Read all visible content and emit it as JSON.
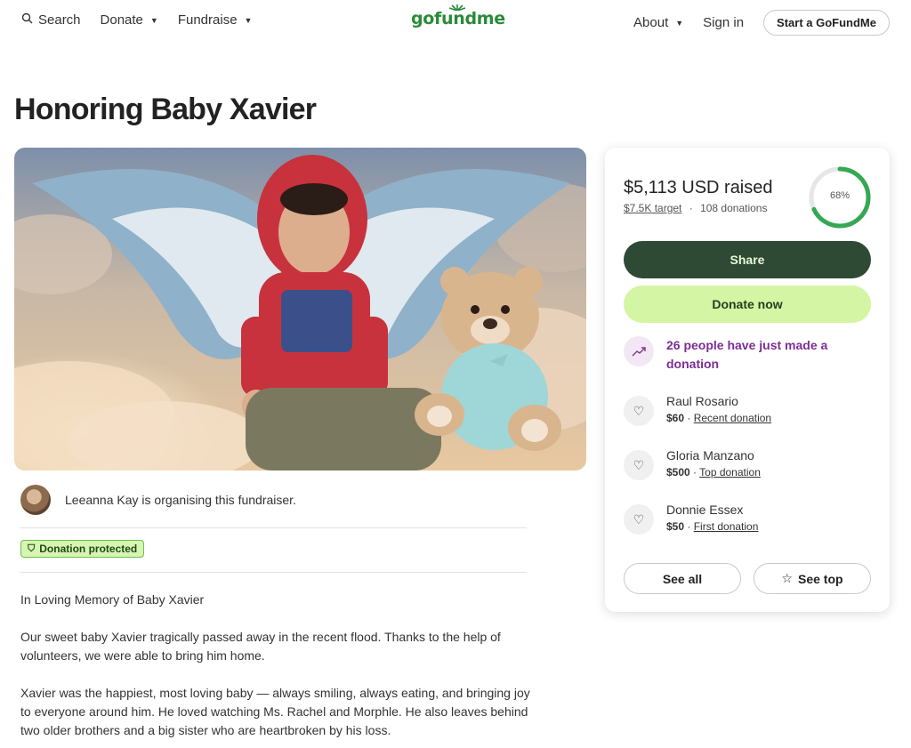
{
  "header": {
    "search_label": "Search",
    "donate_label": "Donate",
    "fundraise_label": "Fundraise",
    "logo_text": "gofundme",
    "about_label": "About",
    "signin_label": "Sign in",
    "start_label": "Start a GoFundMe"
  },
  "page": {
    "title": "Honoring Baby Xavier"
  },
  "organiser": {
    "text": "Leeanna Kay is organising this fundraiser."
  },
  "badge": {
    "label": "Donation protected"
  },
  "story": {
    "paragraphs": [
      "In Loving Memory of Baby Xavier",
      "Our sweet baby Xavier tragically passed away in the recent flood. Thanks to the help of volunteers, we were able to bring him home.",
      "Xavier was the happiest, most loving baby — always smiling, always eating, and bringing joy to everyone around him. He loved watching Ms. Rachel and Morphle. He also leaves behind two older brothers and a big sister who are heartbroken by his loss."
    ]
  },
  "card": {
    "raised": "$5,113 USD raised",
    "target": "$7.5K target",
    "separator": "·",
    "donations": "108 donations",
    "progress_label": "68%",
    "progress_fraction": 0.68,
    "share_label": "Share",
    "donate_label": "Donate now",
    "activity_text": "26 people have just made a donation",
    "donors": [
      {
        "name": "Raul Rosario",
        "amount": "$60",
        "tag": "Recent donation"
      },
      {
        "name": "Gloria Manzano",
        "amount": "$500",
        "tag": "Top donation"
      },
      {
        "name": "Donnie Essex",
        "amount": "$50",
        "tag": "First donation"
      }
    ],
    "see_all_label": "See all",
    "see_top_label": "See top"
  },
  "colors": {
    "brand_green": "#2a8b3a",
    "share_button": "#2e4a35",
    "donate_button": "#d4f5a3",
    "activity_purple": "#7b2e95",
    "progress_ring": "#35a853"
  }
}
